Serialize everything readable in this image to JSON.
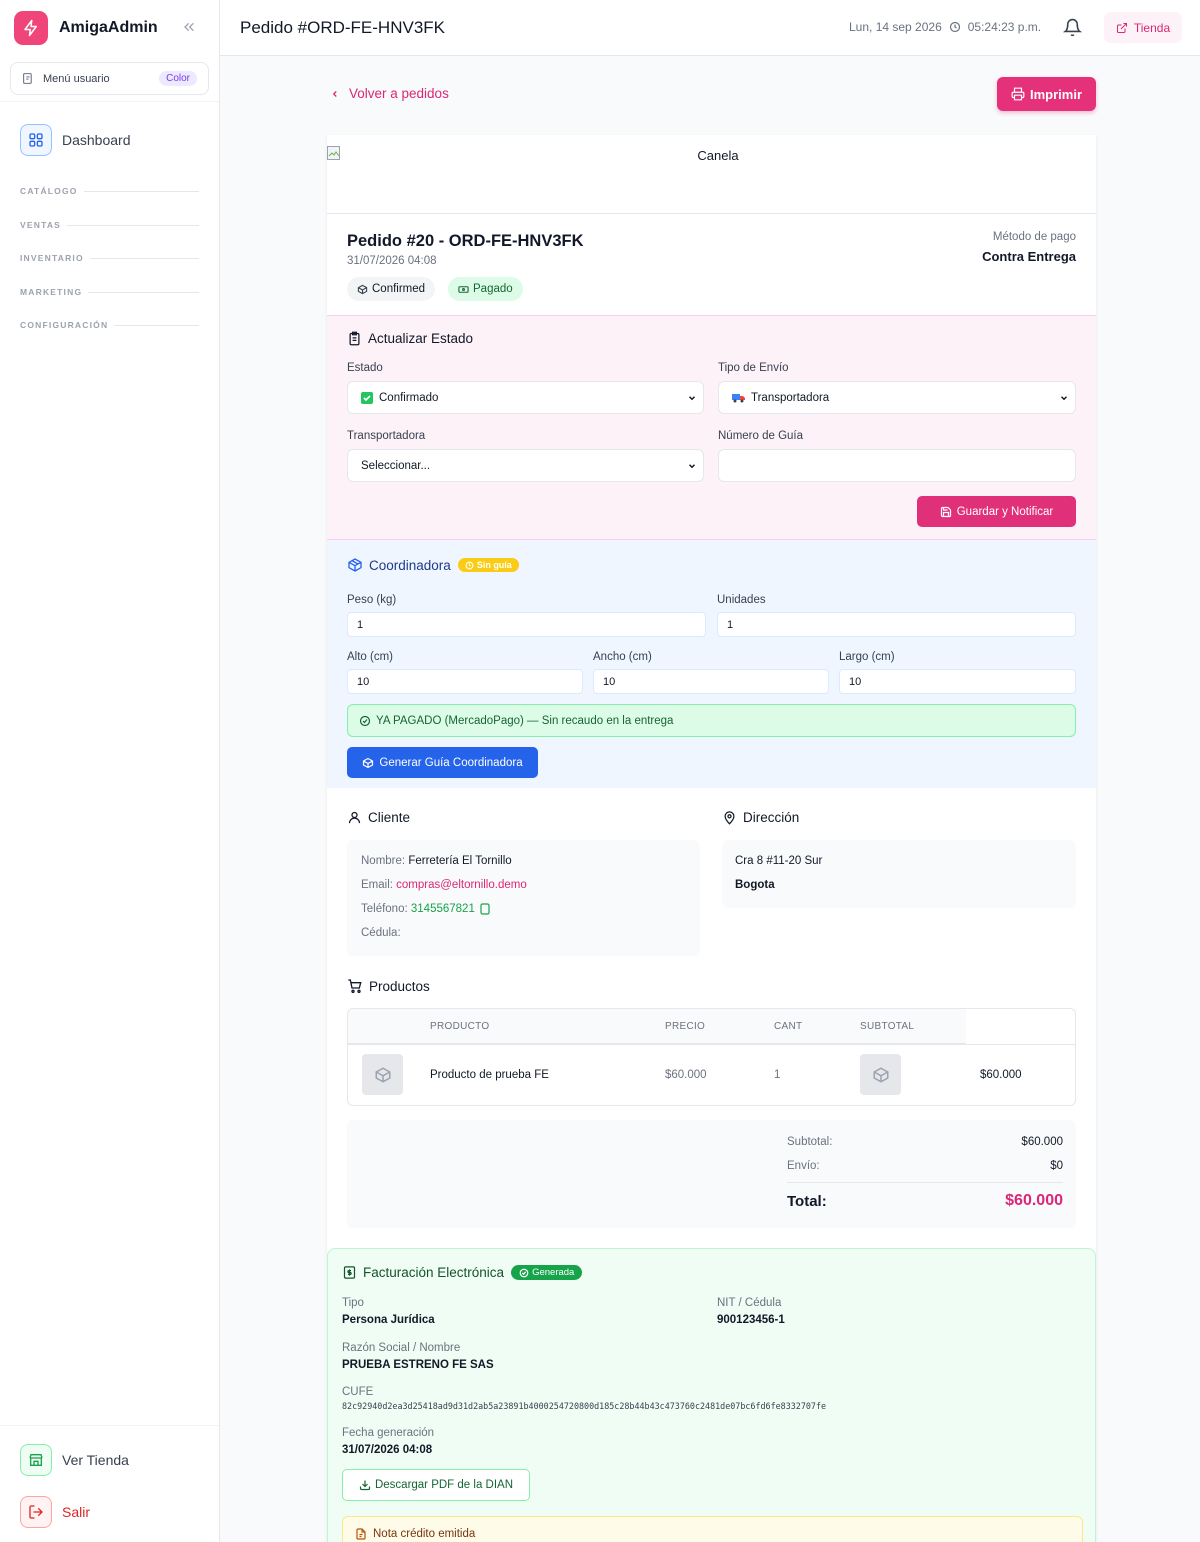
{
  "app": {
    "name": "AmigaAdmin"
  },
  "user_menu": {
    "label": "Menú usuario",
    "badge": "Color"
  },
  "sidebar": {
    "dashboard": "Dashboard",
    "sections": [
      "CATÁLOGO",
      "VENTAS",
      "INVENTARIO",
      "MARKETING",
      "CONFIGURACIÓN"
    ],
    "view_store": "Ver Tienda",
    "logout": "Salir"
  },
  "header": {
    "title": "Pedido #ORD-FE-HNV3FK",
    "date": "Lun, 14 sep 2026",
    "time": "05:24:23 p.m.",
    "store_button": "Tienda"
  },
  "nav": {
    "back": "Volver a pedidos",
    "print": "Imprimir"
  },
  "store_logo_alt": "Canela",
  "order": {
    "title": "Pedido #20 - ORD-FE-HNV3FK",
    "date": "31/07/2026 04:08",
    "status_badge": "Confirmed",
    "payment_badge": "Pagado",
    "payment_method_label": "Método de pago",
    "payment_method": "Contra Entrega"
  },
  "update_status": {
    "title": "Actualizar Estado",
    "estado_label": "Estado",
    "estado_value": "Confirmado",
    "envio_label": "Tipo de Envío",
    "envio_value": "Transportadora",
    "carrier_label": "Transportadora",
    "carrier_value": "Seleccionar...",
    "guide_label": "Número de Guía",
    "guide_value": "",
    "save_button": "Guardar y Notificar"
  },
  "coordinadora": {
    "title": "Coordinadora",
    "badge": "Sin guía",
    "peso_label": "Peso (kg)",
    "peso": "1",
    "unidades_label": "Unidades",
    "unidades": "1",
    "alto_label": "Alto (cm)",
    "alto": "10",
    "ancho_label": "Ancho (cm)",
    "ancho": "10",
    "largo_label": "Largo (cm)",
    "largo": "10",
    "paid_notice": "YA PAGADO (MercadoPago) — Sin recaudo en la entrega",
    "generate_button": "Generar Guía Coordinadora"
  },
  "customer": {
    "title": "Cliente",
    "name_label": "Nombre:",
    "name": "Ferretería El Tornillo",
    "email_label": "Email:",
    "email": "compras@eltornillo.demo",
    "phone_label": "Teléfono:",
    "phone": "3145567821",
    "id_label": "Cédula:"
  },
  "address": {
    "title": "Dirección",
    "line": "Cra 8 #11-20 Sur",
    "city": "Bogota"
  },
  "products": {
    "title": "Productos",
    "headers": [
      "PRODUCTO",
      "PRECIO",
      "CANT",
      "SUBTOTAL"
    ],
    "rows": [
      {
        "name": "Producto de prueba FE",
        "price": "$60.000",
        "qty": "1",
        "subtotal": "$60.000"
      }
    ]
  },
  "totals": {
    "subtotal_label": "Subtotal:",
    "subtotal": "$60.000",
    "shipping_label": "Envío:",
    "shipping": "$0",
    "total_label": "Total:",
    "total": "$60.000"
  },
  "invoice": {
    "title": "Facturación Electrónica",
    "badge": "Generada",
    "tipo_label": "Tipo",
    "tipo": "Persona Jurídica",
    "nit_label": "NIT / Cédula",
    "nit": "900123456-1",
    "razon_label": "Razón Social / Nombre",
    "razon": "PRUEBA ESTRENO FE SAS",
    "cufe_label": "CUFE",
    "cufe": "82c92940d2ea3d25418ad9d31d2ab5a23891b4000254720800d185c28b44b43c473760c2481de07bc6fd6fe8332707fe",
    "fecha_label": "Fecha generación",
    "fecha": "31/07/2026 04:08",
    "download_button": "Descargar PDF de la DIAN",
    "credit_note": "Nota crédito emitida"
  },
  "colors": {
    "brand": "#f0457a",
    "accent_pink": "#db2777",
    "accent_blue": "#2563eb",
    "success": "#16a34a",
    "warning": "#facc15"
  }
}
